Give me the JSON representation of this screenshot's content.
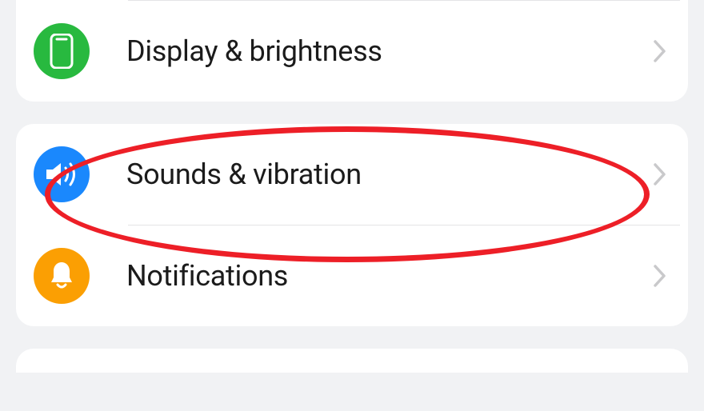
{
  "settings": {
    "group1": {
      "items": [
        {
          "label": "Display & brightness",
          "icon": "display"
        }
      ]
    },
    "group2": {
      "items": [
        {
          "label": "Sounds & vibration",
          "icon": "sound"
        },
        {
          "label": "Notifications",
          "icon": "bell"
        }
      ]
    }
  },
  "colors": {
    "display": "#28b93f",
    "sound": "#1a88fd",
    "bell": "#fb9f03",
    "highlight": "#ed1f27"
  }
}
